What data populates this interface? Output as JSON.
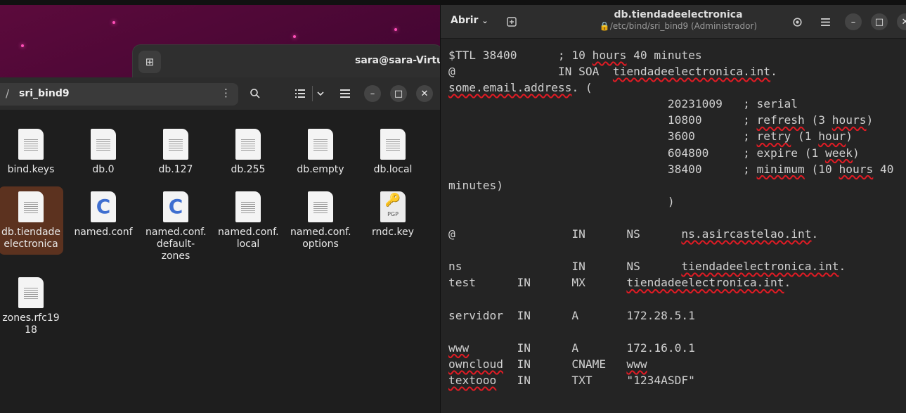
{
  "terminal": {
    "title": "sara@sara-Virtual"
  },
  "file_manager": {
    "current_folder": "sri_bind9",
    "path_separator": "/",
    "files": [
      {
        "name": "bind.keys",
        "type": "text"
      },
      {
        "name": "db.0",
        "type": "text"
      },
      {
        "name": "db.127",
        "type": "text"
      },
      {
        "name": "db.255",
        "type": "text"
      },
      {
        "name": "db.empty",
        "type": "text"
      },
      {
        "name": "db.local",
        "type": "text"
      },
      {
        "name": "db.tiendade electronica",
        "type": "text",
        "selected": true
      },
      {
        "name": "named.conf",
        "type": "c"
      },
      {
        "name": "named.conf. default-zones",
        "type": "c"
      },
      {
        "name": "named.conf. local",
        "type": "text"
      },
      {
        "name": "named.conf. options",
        "type": "text"
      },
      {
        "name": "rndc.key",
        "type": "key",
        "badge": "PGP"
      },
      {
        "name": "zones.rfc19 18",
        "type": "text"
      }
    ]
  },
  "editor": {
    "open_label": "Abrir",
    "title": "db.tiendadeelectronica",
    "subtitle": "/etc/bind/sri_bind9 (Administrador)",
    "lines": [
      [
        {
          "t": "$TTL 38400      ; 10 "
        },
        {
          "t": "hours",
          "s": true
        },
        {
          "t": " 40 minutes"
        }
      ],
      [
        {
          "t": "@               IN SOA  "
        },
        {
          "t": "tiendadeelectronica.int",
          "s": true
        },
        {
          "t": "."
        }
      ],
      [
        {
          "t": "some.email.address",
          "s": true
        },
        {
          "t": ". ("
        }
      ],
      [
        {
          "t": "                                20231009   ; serial"
        }
      ],
      [
        {
          "t": "                                10800      ; "
        },
        {
          "t": "refresh",
          "s": true
        },
        {
          "t": " (3 "
        },
        {
          "t": "hours",
          "s": true
        },
        {
          "t": ")"
        }
      ],
      [
        {
          "t": "                                3600       ; "
        },
        {
          "t": "retry",
          "s": true
        },
        {
          "t": " (1 "
        },
        {
          "t": "hour",
          "s": true
        },
        {
          "t": ")"
        }
      ],
      [
        {
          "t": "                                604800     ; expire (1 "
        },
        {
          "t": "week",
          "s": true
        },
        {
          "t": ")"
        }
      ],
      [
        {
          "t": "                                38400      ; "
        },
        {
          "t": "minimum",
          "s": true
        },
        {
          "t": " (10 "
        },
        {
          "t": "hours",
          "s": true
        },
        {
          "t": " 40"
        }
      ],
      [
        {
          "t": "minutes)"
        }
      ],
      [
        {
          "t": "                                )"
        }
      ],
      [
        {
          "t": ""
        }
      ],
      [
        {
          "t": "@                 IN      NS      "
        },
        {
          "t": "ns.asircastelao.int",
          "s": true
        },
        {
          "t": "."
        }
      ],
      [
        {
          "t": ""
        }
      ],
      [
        {
          "t": "ns                IN      NS      "
        },
        {
          "t": "tiendadeelectronica.int",
          "s": true
        },
        {
          "t": "."
        }
      ],
      [
        {
          "t": "test      IN      MX      "
        },
        {
          "t": "tiendadeelectronica.int",
          "s": true
        },
        {
          "t": "."
        }
      ],
      [
        {
          "t": ""
        }
      ],
      [
        {
          "t": "servidor  IN      A       172.28.5.1"
        }
      ],
      [
        {
          "t": ""
        }
      ],
      [
        {
          "t": "www",
          "s": true
        },
        {
          "t": "       IN      A       172.16.0.1"
        }
      ],
      [
        {
          "t": "owncloud",
          "s": true
        },
        {
          "t": "  IN      CNAME   "
        },
        {
          "t": "www",
          "s": true
        }
      ],
      [
        {
          "t": "textooo",
          "s": true
        },
        {
          "t": "   IN      TXT     \"1234ASDF\""
        }
      ]
    ]
  },
  "colors": {
    "selection": "#5c321f",
    "spell_error": "#e01b24",
    "accent_c_icon": "#3f6fd0"
  }
}
